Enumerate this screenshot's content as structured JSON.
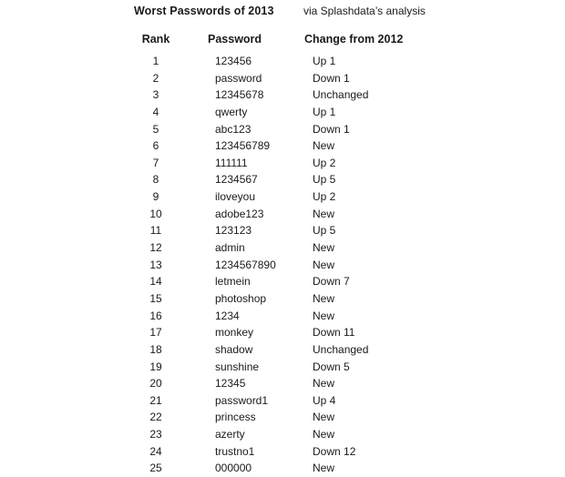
{
  "document": {
    "title": "Worst Passwords of 2013",
    "subtitle": "via Splashdata’s analysis",
    "background_color": "#ffffff",
    "text_color": "#1a1a1a"
  },
  "table": {
    "columns": [
      "Rank",
      "Password",
      "Change from 2012"
    ],
    "rows": [
      {
        "rank": "1",
        "password": "123456",
        "change": "Up 1"
      },
      {
        "rank": "2",
        "password": "password",
        "change": "Down 1"
      },
      {
        "rank": "3",
        "password": "12345678",
        "change": "Unchanged"
      },
      {
        "rank": "4",
        "password": "qwerty",
        "change": "Up 1"
      },
      {
        "rank": "5",
        "password": "abc123",
        "change": "Down 1"
      },
      {
        "rank": "6",
        "password": "123456789",
        "change": "New"
      },
      {
        "rank": "7",
        "password": "111111",
        "change": "Up 2"
      },
      {
        "rank": "8",
        "password": "1234567",
        "change": "Up 5"
      },
      {
        "rank": "9",
        "password": "iloveyou",
        "change": "Up 2"
      },
      {
        "rank": "10",
        "password": "adobe123",
        "change": "New"
      },
      {
        "rank": "11",
        "password": "123123",
        "change": "Up 5"
      },
      {
        "rank": "12",
        "password": "admin",
        "change": "New"
      },
      {
        "rank": "13",
        "password": "1234567890",
        "change": "New"
      },
      {
        "rank": "14",
        "password": "letmein",
        "change": "Down 7"
      },
      {
        "rank": "15",
        "password": "photoshop",
        "change": "New"
      },
      {
        "rank": "16",
        "password": "1234",
        "change": "New"
      },
      {
        "rank": "17",
        "password": "monkey",
        "change": "Down 11"
      },
      {
        "rank": "18",
        "password": "shadow",
        "change": "Unchanged"
      },
      {
        "rank": "19",
        "password": "sunshine",
        "change": "Down 5"
      },
      {
        "rank": "20",
        "password": "12345",
        "change": "New"
      },
      {
        "rank": "21",
        "password": "password1",
        "change": "Up 4"
      },
      {
        "rank": "22",
        "password": "princess",
        "change": "New"
      },
      {
        "rank": "23",
        "password": "azerty",
        "change": "New"
      },
      {
        "rank": "24",
        "password": "trustno1",
        "change": "Down 12"
      },
      {
        "rank": "25",
        "password": "000000",
        "change": "New"
      }
    ]
  }
}
